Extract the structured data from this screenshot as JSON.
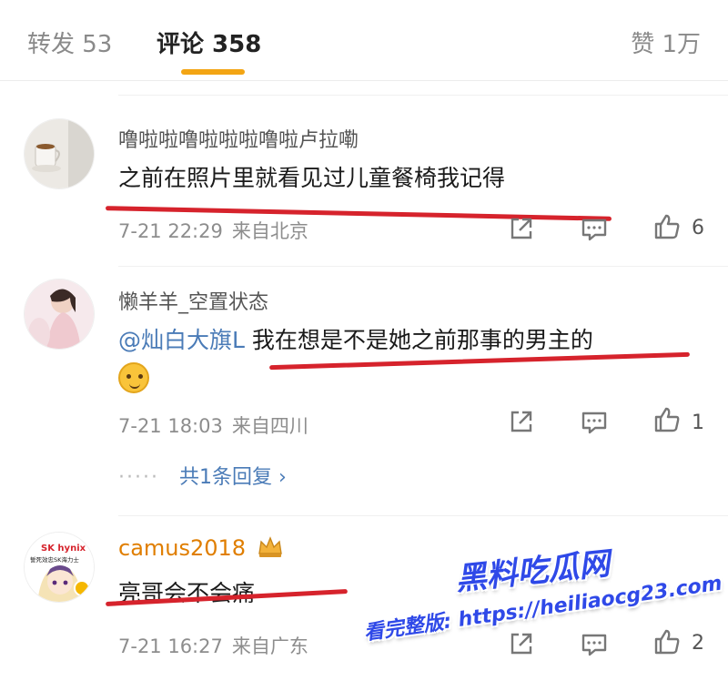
{
  "tabs": {
    "repost": "转发 53",
    "comments": "评论 358",
    "likes": "赞 1万"
  },
  "comments": [
    {
      "username": "噜啦啦噜啦啦啦噜啦卢拉嘞",
      "text": "之前在照片里就看见过儿童餐椅我记得",
      "time": "7-21 22:29",
      "location": "来自北京",
      "like_count": "6"
    },
    {
      "username": "懒羊羊_空置状态",
      "mention": "@灿白大旗L",
      "text": "我在想是不是她之前那事的男主的",
      "time": "7-21 18:03",
      "location": "来自四川",
      "like_count": "1",
      "replies_link": "共1条回复 ›"
    },
    {
      "username": "camus2018",
      "text": "亮哥会不会痛",
      "time": "7-21 16:27",
      "location": "来自广东",
      "like_count": "2"
    }
  ],
  "avatar3": {
    "brand": "SK hynix",
    "caption": "誓死效忠SK海力士"
  },
  "watermark": {
    "title": "黑料吃瓜网",
    "subtitle": "看完整版: https://heiliaocg23.com"
  },
  "colors": {
    "accent": "#f3a514",
    "mention": "#4a7bb7",
    "underline": "#d6232c",
    "watermark": "#2f49e8"
  }
}
